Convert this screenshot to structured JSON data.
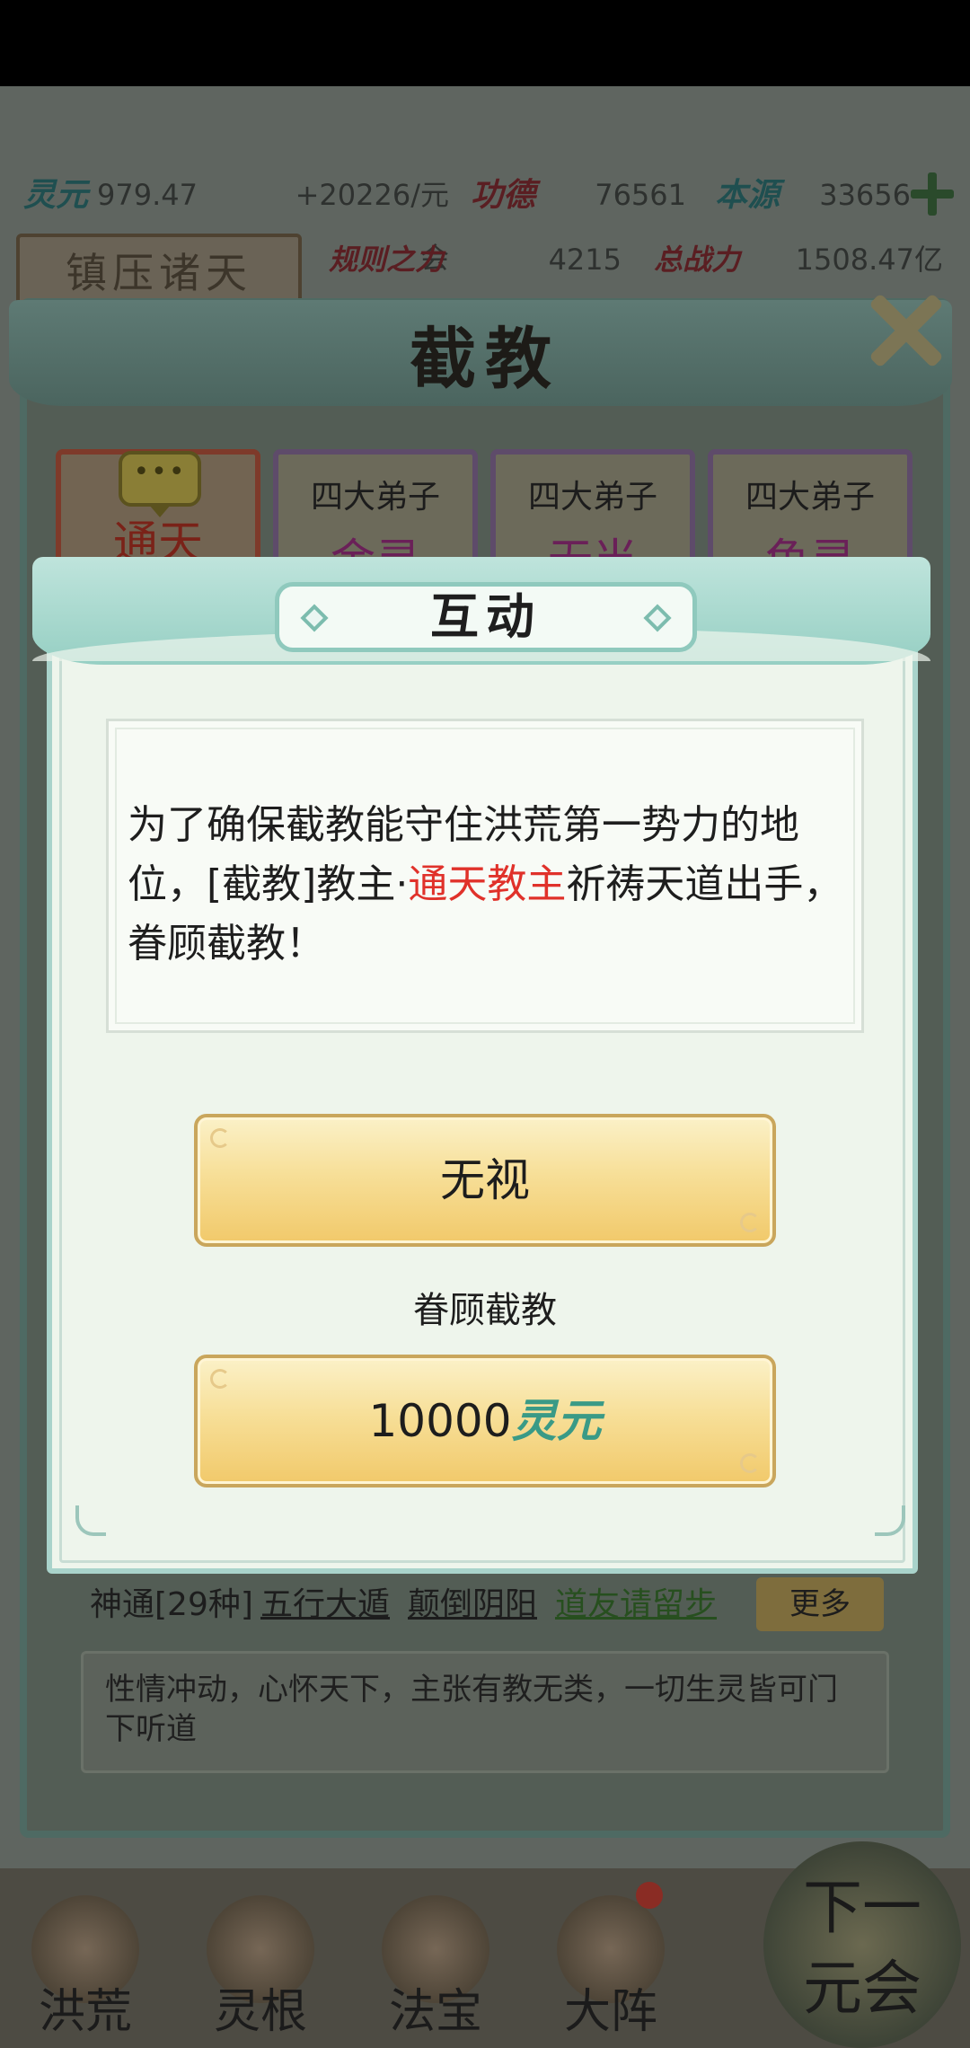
{
  "resources": {
    "row1": [
      {
        "name": "灵元",
        "value": "979.47万",
        "rate": "+20226/元会"
      },
      {
        "name": "功德",
        "value": "76561"
      },
      {
        "name": "本源",
        "value": "33656"
      }
    ],
    "row2": [
      {
        "name": "规则之力",
        "value": "4215"
      },
      {
        "name": "总战力",
        "value": "1508.47亿"
      }
    ]
  },
  "region_tab": "镇压诸天",
  "panel": {
    "title": "截教",
    "characters": [
      {
        "subtitle": "",
        "name": "通天"
      },
      {
        "subtitle": "四大弟子",
        "name": "金灵"
      },
      {
        "subtitle": "四大弟子",
        "name": "无当"
      },
      {
        "subtitle": "四大弟子",
        "name": "龟灵"
      }
    ],
    "chat_bubble": "•••",
    "skills": {
      "count_label": "神通[29种]",
      "items": [
        "五行大遁",
        "颠倒阴阳",
        "道友请留步"
      ],
      "more_label": "更多"
    },
    "description": "性情冲动，心怀天下，主张有教无类，一切生灵皆可门下听道"
  },
  "dialog": {
    "title": "互动",
    "message_parts": {
      "before": "为了确保截教能守住洪荒第一势力的地位，[截教]教主·",
      "highlight": "通天教主",
      "after": "祈祷天道出手，眷顾截教！"
    },
    "highlight_color": "#e0312a",
    "ignore_label": "无视",
    "action_caption": "眷顾截教",
    "cost_amount": "10000",
    "cost_currency": "灵元"
  },
  "bottom_nav": {
    "items": [
      "洪荒",
      "灵根",
      "法宝",
      "大阵"
    ],
    "next_era_line1": "下一",
    "next_era_line2": "元会"
  }
}
